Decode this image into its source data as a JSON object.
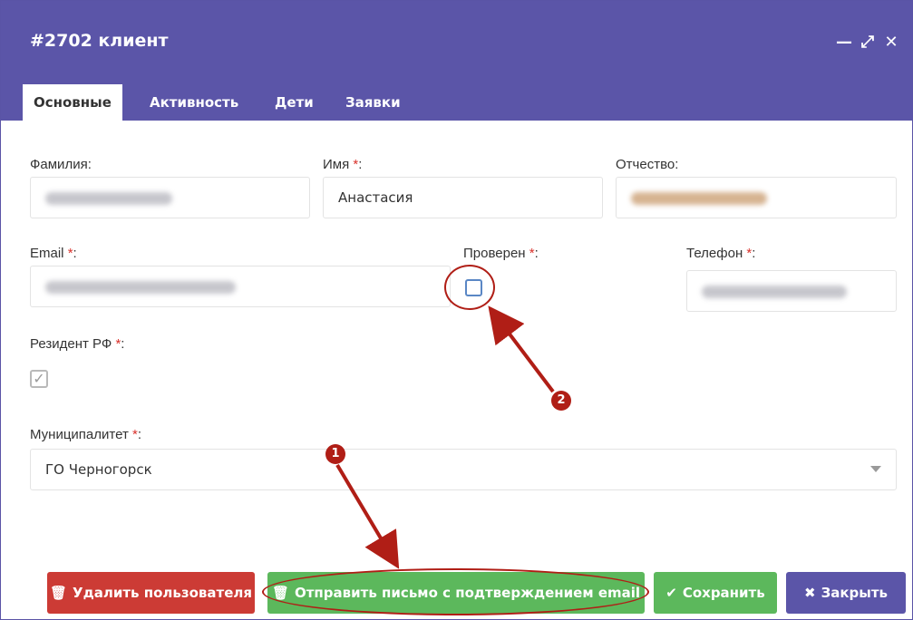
{
  "window": {
    "title": "#2702 клиент"
  },
  "controls": {
    "minimize": "—",
    "maximize": "⤢",
    "close": "✕"
  },
  "tabs": [
    {
      "label": "Основные",
      "active": true
    },
    {
      "label": "Активность"
    },
    {
      "label": "Дети"
    },
    {
      "label": "Заявки"
    }
  ],
  "form": {
    "lastname_label": "Фамилия:",
    "firstname_label": "Имя",
    "firstname_value": "Анастасия",
    "patronymic_label": "Отчество:",
    "email_label": "Email",
    "verified_label": "Проверен",
    "verified_checked": false,
    "phone_label": "Телефон",
    "resident_label": "Резидент РФ",
    "resident_checked": true,
    "municipality_label": "Муниципалитет",
    "municipality_value": "ГО Черногорск",
    "required_mark": "*",
    "colon": ":"
  },
  "buttons": {
    "delete": "Удалить пользователя",
    "send_email": "Отправить письмо с подтверждением email",
    "save": "Сохранить",
    "close": "Закрыть"
  },
  "annotations": {
    "badge1": "1",
    "badge2": "2"
  },
  "colors": {
    "header": "#5b55a8",
    "danger": "#cc3b35",
    "success": "#5cb85c",
    "annotation": "#b01e16",
    "required": "#d9312b"
  }
}
